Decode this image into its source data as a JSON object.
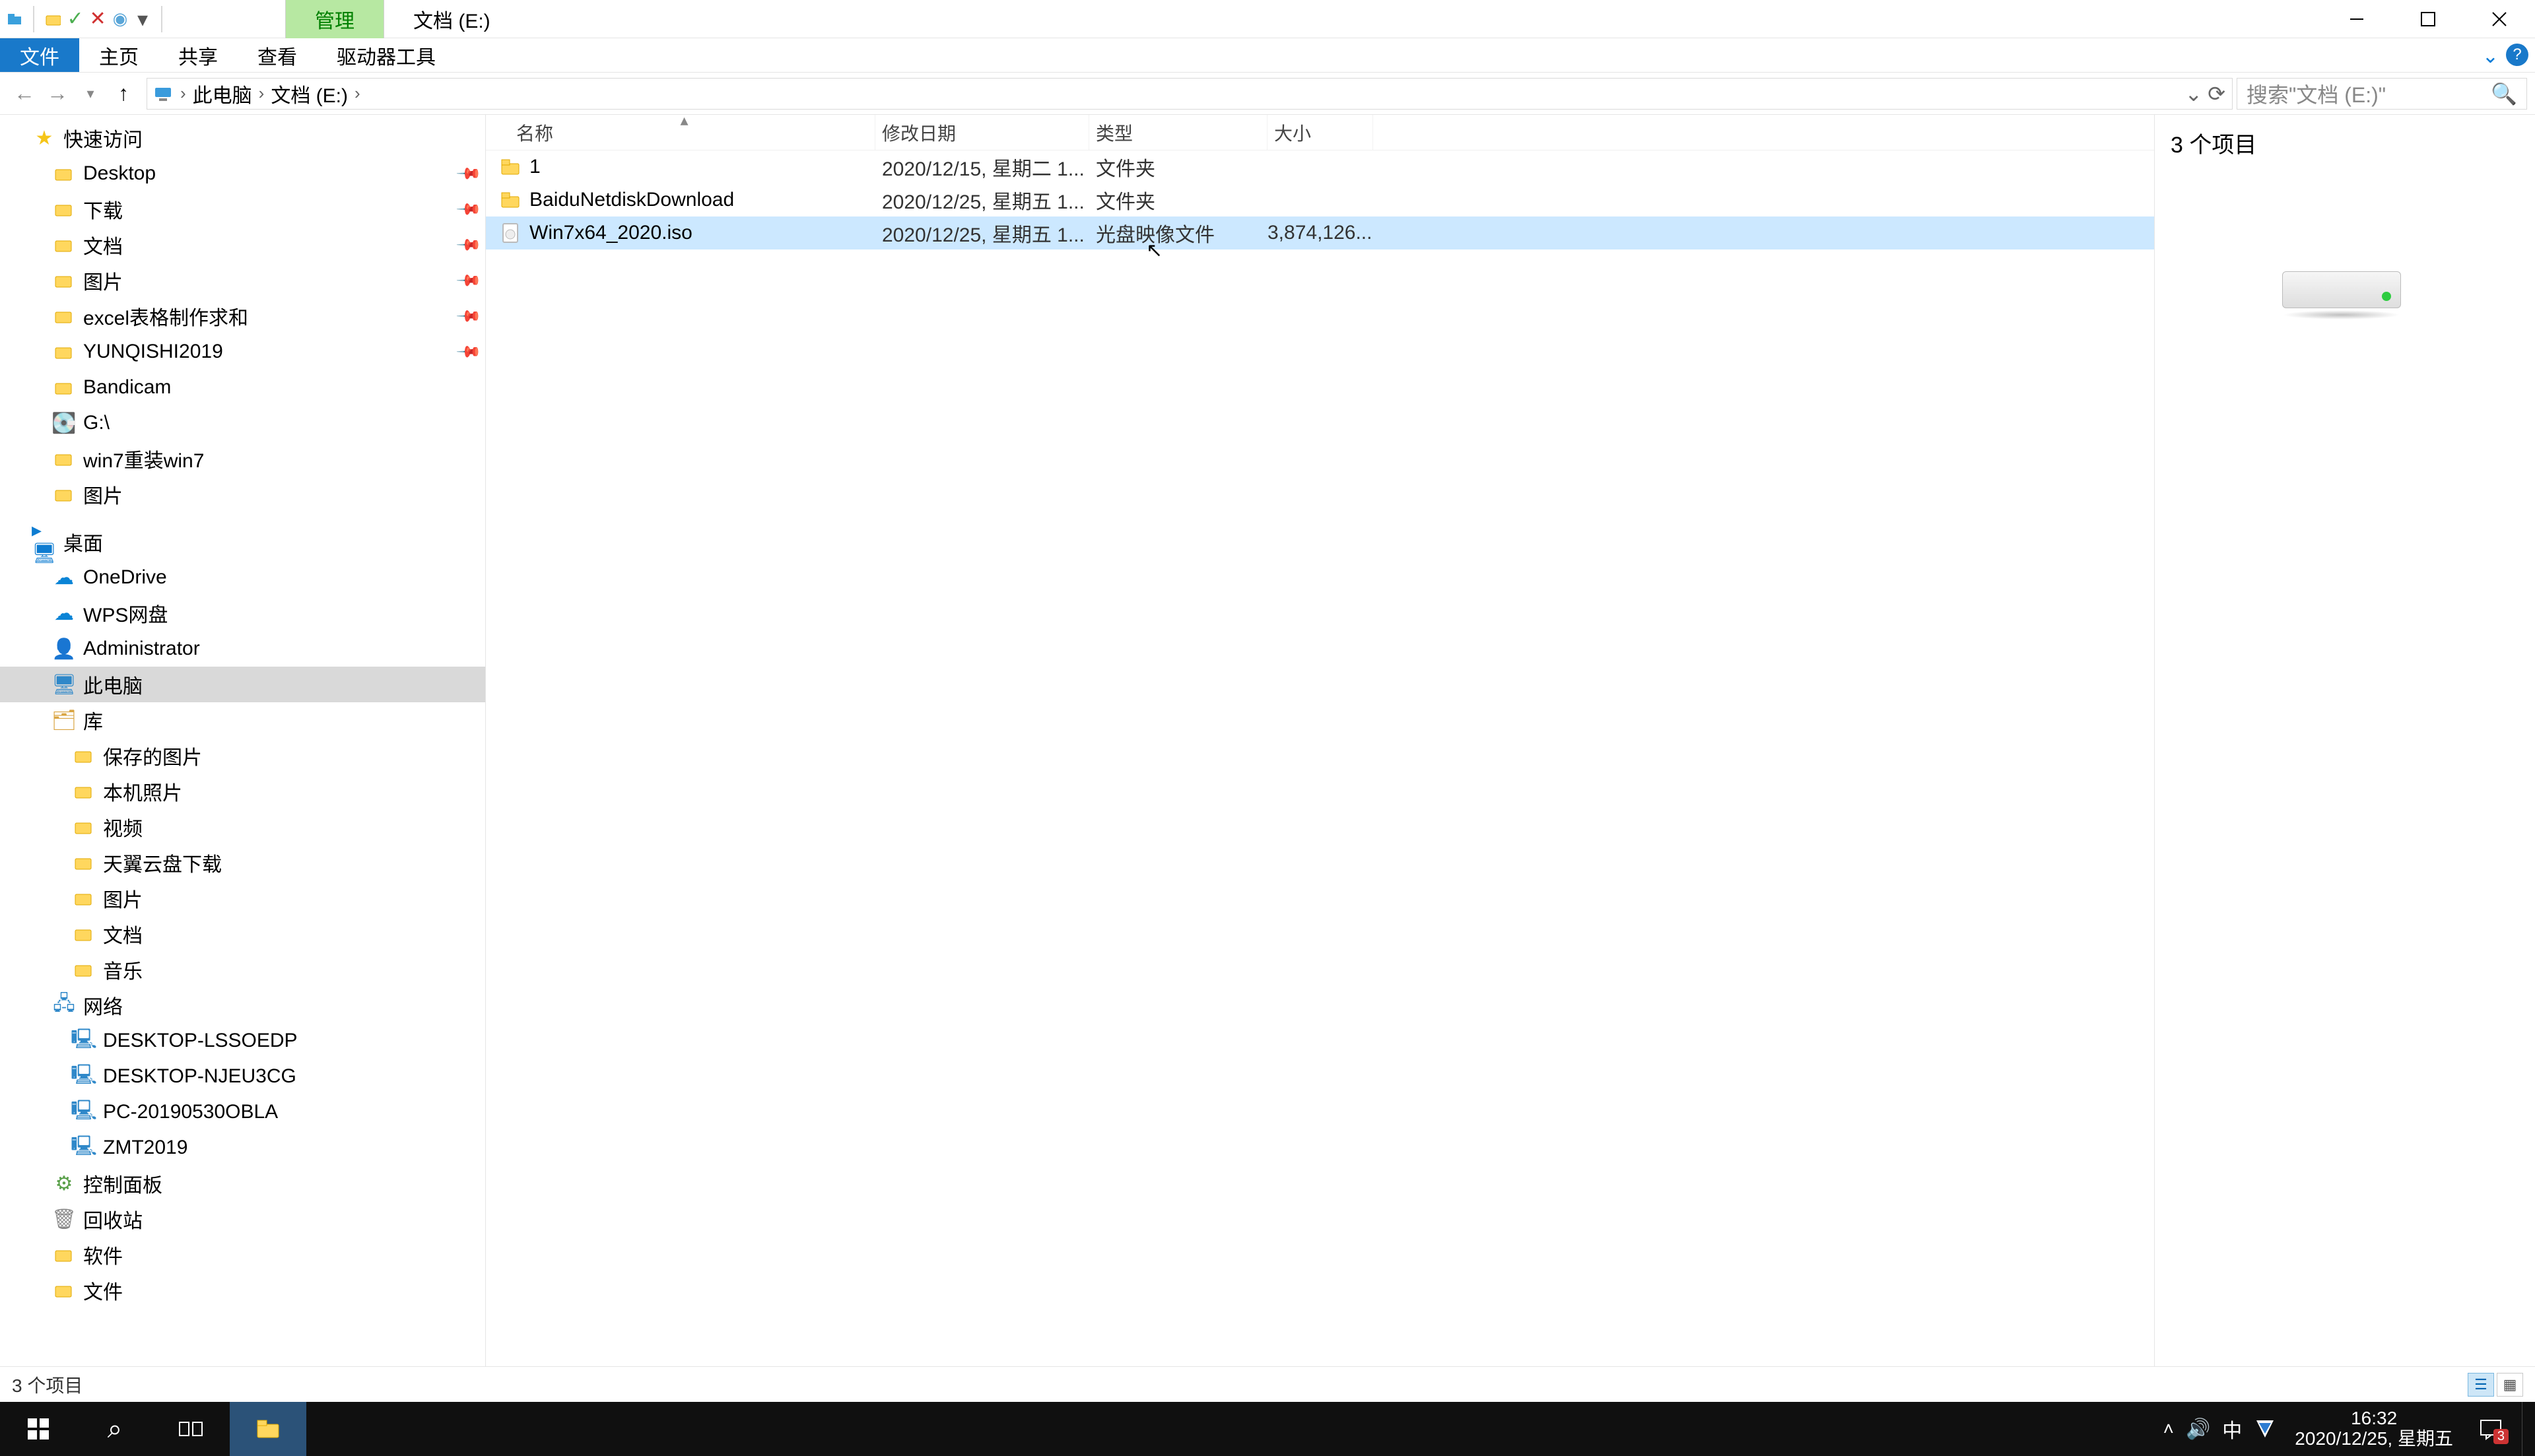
{
  "titlebar": {
    "manage_tab": "管理",
    "location_tab": "文档 (E:)"
  },
  "ribbon": {
    "file": "文件",
    "home": "主页",
    "share": "共享",
    "view": "查看",
    "drive_tools": "驱动器工具",
    "help": "?"
  },
  "address": {
    "this_pc": "此电脑",
    "drive": "文档 (E:)",
    "refresh": "⟳"
  },
  "search": {
    "placeholder": "搜索\"文档 (E:)\""
  },
  "sidebar": {
    "quick_access": "快速访问",
    "items_pinned": [
      {
        "label": "Desktop"
      },
      {
        "label": "下载"
      },
      {
        "label": "文档"
      },
      {
        "label": "图片"
      },
      {
        "label": "excel表格制作求和"
      },
      {
        "label": "YUNQISHI2019"
      }
    ],
    "items_recent": [
      {
        "label": "Bandicam"
      },
      {
        "label": "G:\\"
      },
      {
        "label": "win7重装win7"
      },
      {
        "label": "图片"
      }
    ],
    "desktop_root": "桌面",
    "desktop_children": [
      {
        "label": "OneDrive"
      },
      {
        "label": "WPS网盘"
      },
      {
        "label": "Administrator"
      },
      {
        "label": "此电脑",
        "selected": true
      },
      {
        "label": "库"
      },
      {
        "label": "保存的图片",
        "indent": 2
      },
      {
        "label": "本机照片",
        "indent": 2
      },
      {
        "label": "视频",
        "indent": 2
      },
      {
        "label": "天翼云盘下载",
        "indent": 2
      },
      {
        "label": "图片",
        "indent": 2
      },
      {
        "label": "文档",
        "indent": 2
      },
      {
        "label": "音乐",
        "indent": 2
      },
      {
        "label": "网络"
      },
      {
        "label": "DESKTOP-LSSOEDP",
        "indent": 2
      },
      {
        "label": "DESKTOP-NJEU3CG",
        "indent": 2
      },
      {
        "label": "PC-20190530OBLA",
        "indent": 2
      },
      {
        "label": "ZMT2019",
        "indent": 2
      },
      {
        "label": "控制面板"
      },
      {
        "label": "回收站"
      },
      {
        "label": "软件"
      },
      {
        "label": "文件"
      }
    ]
  },
  "columns": {
    "name": "名称",
    "date": "修改日期",
    "type": "类型",
    "size": "大小"
  },
  "rows": [
    {
      "name": "1",
      "date": "2020/12/15, 星期二 1...",
      "type": "文件夹",
      "size": "",
      "icon": "folder"
    },
    {
      "name": "BaiduNetdiskDownload",
      "date": "2020/12/25, 星期五 1...",
      "type": "文件夹",
      "size": "",
      "icon": "folder"
    },
    {
      "name": "Win7x64_2020.iso",
      "date": "2020/12/25, 星期五 1...",
      "type": "光盘映像文件",
      "size": "3,874,126...",
      "icon": "iso",
      "selected": true
    }
  ],
  "preview": {
    "title": "3 个项目"
  },
  "status": {
    "text": "3 个项目"
  },
  "taskbar": {
    "time": "16:32",
    "date": "2020/12/25, 星期五",
    "ime": "中",
    "badge": "3"
  }
}
